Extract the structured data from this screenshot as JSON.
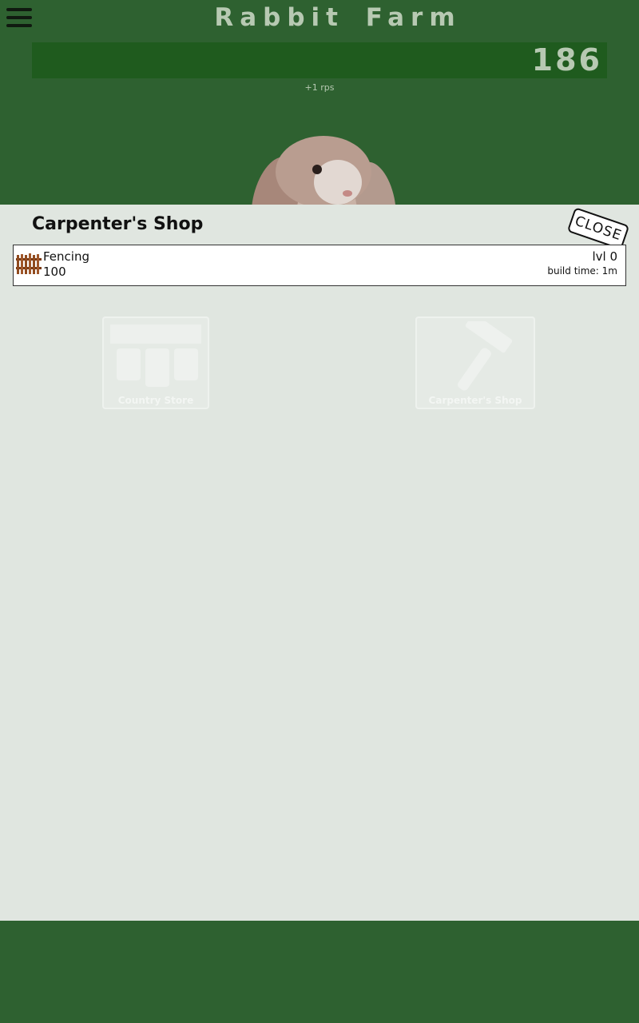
{
  "app": {
    "title": "Rabbit Farm",
    "score": "186",
    "rate": "+1 rps"
  },
  "icons": {
    "menu": "hamburger-menu-icon",
    "rabbit": "rabbit-image",
    "fencing": "fence-icon"
  },
  "background": {
    "buildings": [
      "Country Store",
      "Carpenter's Shop"
    ]
  },
  "modal": {
    "title": "Carpenter's Shop",
    "close_label": "CLOSE",
    "items": [
      {
        "name": "Fencing",
        "cost": "100",
        "level": "lvl 0",
        "build_time": "build time: 1m"
      }
    ]
  },
  "colors": {
    "header_bg": "#2e6130",
    "score_bar": "#1f5b1e",
    "modal_bg": "#e0e6e0"
  }
}
